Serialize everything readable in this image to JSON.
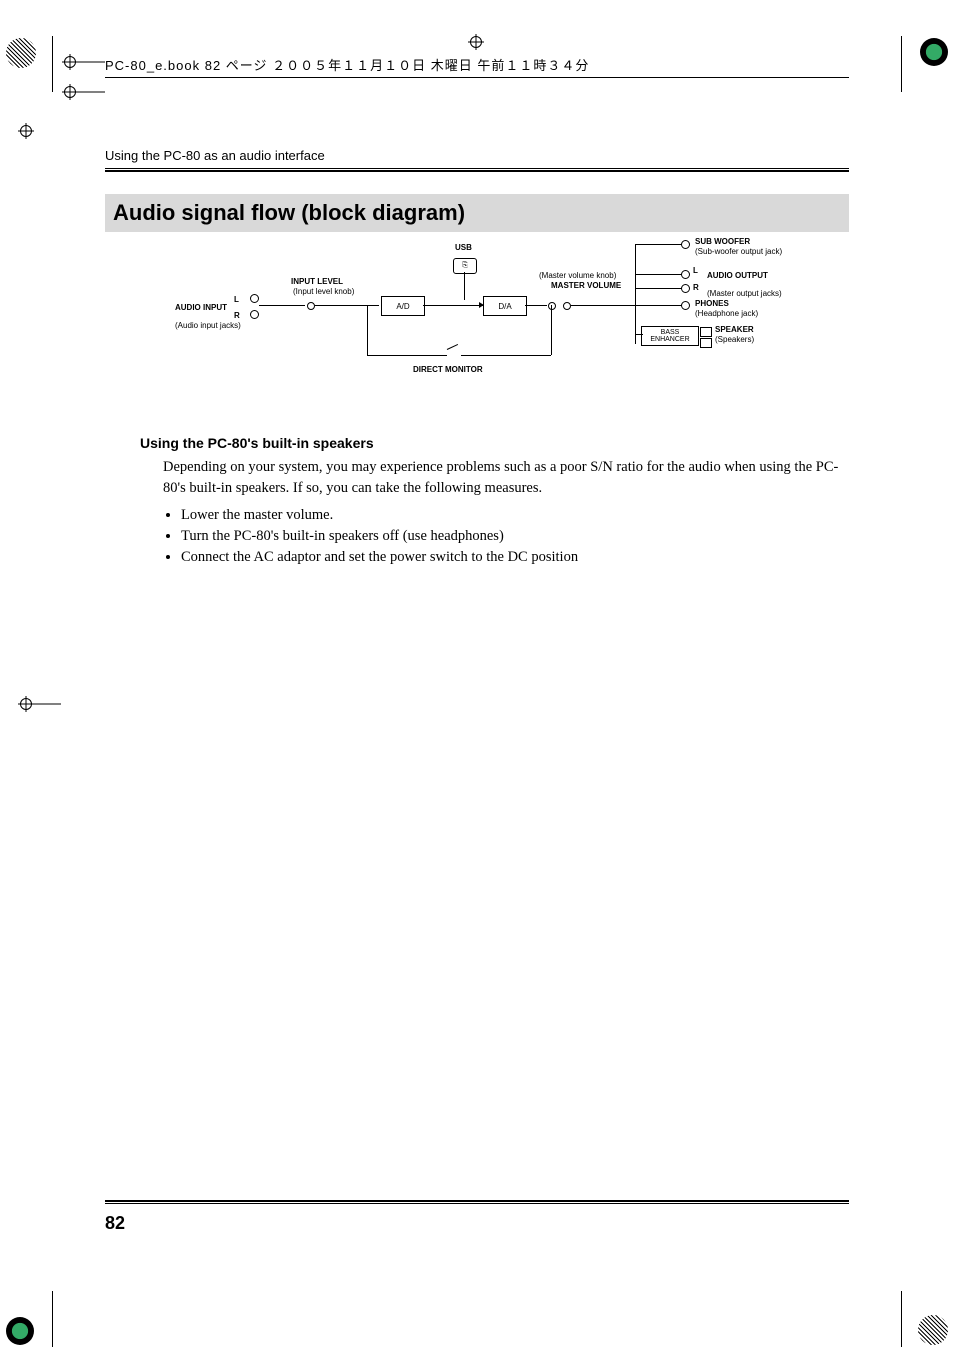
{
  "header": {
    "print_info": "PC-80_e.book 82 ページ ２００５年１１月１０日 木曜日 午前１１時３４分"
  },
  "running_head": "Using the PC-80 as an audio interface",
  "section_title": "Audio signal flow (block diagram)",
  "sub_title": "Using the PC-80's built-in speakers",
  "paragraph": "Depending on your system, you may experience problems such as a poor S/N ratio for the audio when using the PC-80's built-in speakers. If so, you can take the following measures.",
  "bullets": [
    "Lower the master volume.",
    "Turn the PC-80's built-in speakers off (use headphones)",
    "Connect the AC adaptor and set the power switch to the DC position"
  ],
  "page_number": "82",
  "diagram": {
    "labels": {
      "usb": "USB",
      "input_level": "INPUT LEVEL",
      "input_level_sub": "(Input level knob)",
      "audio_input": "AUDIO INPUT",
      "audio_input_sub": "(Audio input jacks)",
      "ad": "A/D",
      "da": "D/A",
      "master_volume": "MASTER VOLUME",
      "master_volume_sub": "(Master volume knob)",
      "sub_woofer": "SUB WOOFER",
      "sub_woofer_sub": "(Sub-woofer output jack)",
      "audio_output": "AUDIO OUTPUT",
      "audio_output_sub": "(Master output jacks)",
      "phones": "PHONES",
      "phones_sub": "(Headphone jack)",
      "bass_enhancer": "BASS ENHANCER",
      "speaker": "SPEAKER",
      "speaker_sub": "(Speakers)",
      "direct_monitor": "DIRECT MONITOR",
      "L": "L",
      "R": "R"
    }
  }
}
